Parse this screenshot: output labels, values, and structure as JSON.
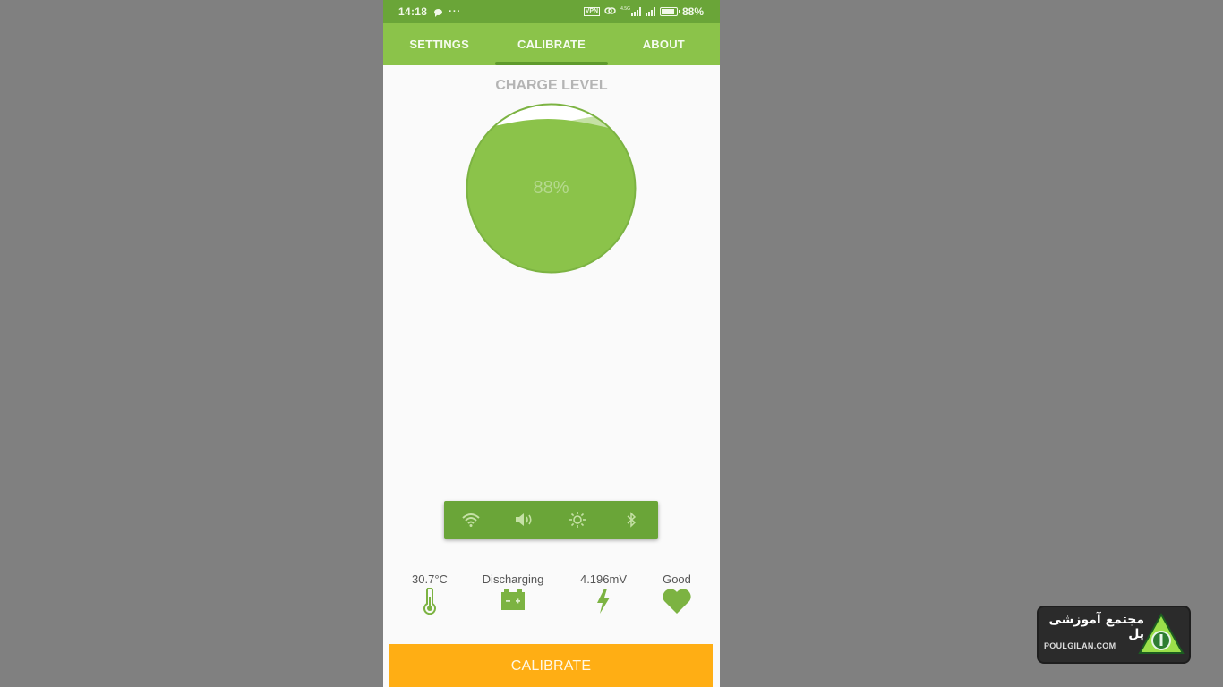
{
  "status_bar": {
    "time": "14:18",
    "overflow": "···",
    "vpn_label": "VPN",
    "network_label": "4.5G",
    "battery_percent": "88%",
    "icons": [
      "message-icon",
      "more-dots-icon",
      "vpn-icon",
      "link-icon",
      "signal-4g-icon",
      "signal-icon",
      "battery-icon"
    ]
  },
  "tabs": [
    {
      "label": "SETTINGS",
      "active": false
    },
    {
      "label": "CALIBRATE",
      "active": true
    },
    {
      "label": "ABOUT",
      "active": false
    }
  ],
  "charge": {
    "title": "CHARGE LEVEL",
    "level_text": "88%",
    "level_fraction": 0.88
  },
  "toggles": [
    {
      "name": "wifi",
      "icon": "wifi-icon"
    },
    {
      "name": "sound",
      "icon": "volume-icon"
    },
    {
      "name": "brightness",
      "icon": "brightness-icon"
    },
    {
      "name": "bluetooth",
      "icon": "bluetooth-icon"
    }
  ],
  "stats": {
    "temperature": {
      "value": "30.7°C",
      "icon": "thermometer-icon"
    },
    "status": {
      "value": "Discharging",
      "icon": "battery-terminal-icon"
    },
    "voltage": {
      "value": "4.196mV",
      "icon": "lightning-icon"
    },
    "health": {
      "value": "Good",
      "icon": "heart-icon"
    }
  },
  "actions": {
    "calibrate_label": "CALIBRATE"
  },
  "watermark": {
    "persian_text": "مجتمع آموزشی پل",
    "site": "POULGILAN.COM"
  },
  "colors": {
    "primary": "#8bc34a",
    "primary_dark": "#6aa538",
    "accent": "#ffae14",
    "background": "#fafafa"
  }
}
